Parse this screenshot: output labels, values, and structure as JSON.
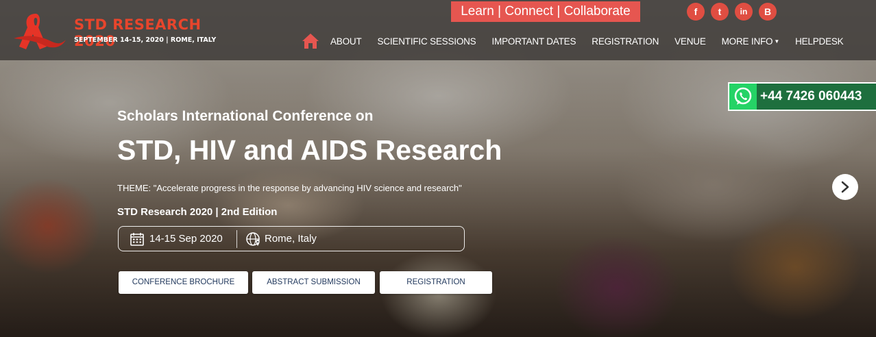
{
  "header": {
    "logo_title": "STD RESEARCH 2020",
    "logo_subtitle": "SEPTEMBER 14-15, 2020 | ROME, ITALY",
    "tagline": "Learn | Connect | Collaborate",
    "social": [
      {
        "icon": "facebook-icon",
        "glyph": "f"
      },
      {
        "icon": "twitter-icon",
        "glyph": "t"
      },
      {
        "icon": "linkedin-icon",
        "glyph": "in"
      },
      {
        "icon": "blogger-icon",
        "glyph": "B"
      }
    ],
    "nav": [
      {
        "label": "ABOUT"
      },
      {
        "label": "SCIENTIFIC SESSIONS"
      },
      {
        "label": "IMPORTANT DATES"
      },
      {
        "label": "REGISTRATION"
      },
      {
        "label": "VENUE"
      },
      {
        "label": "MORE INFO"
      },
      {
        "label": "HELPDESK"
      }
    ]
  },
  "whatsapp": {
    "number": "+44 7426 060443"
  },
  "hero": {
    "pre_title": "Scholars International Conference on",
    "title": "STD, HIV and AIDS Research",
    "theme": "THEME: \"Accelerate progress in the response by advancing HIV science and research\"",
    "edition": "STD Research 2020 | 2nd Edition",
    "date": "14-15 Sep 2020",
    "location": "Rome, Italy",
    "buttons": {
      "brochure": "CONFERENCE BROCHURE",
      "abstract": "ABSTRACT SUBMISSION",
      "registration": "REGISTRATION"
    }
  },
  "colors": {
    "accent": "#e65650",
    "topbar": "#3c3836",
    "whatsapp": "#25d366",
    "button_text": "#233a5e"
  }
}
